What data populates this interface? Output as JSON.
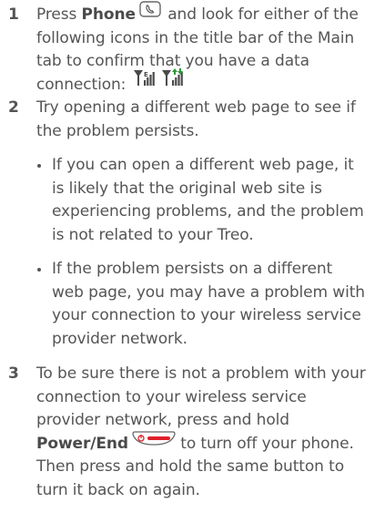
{
  "steps": [
    {
      "number": "1",
      "pre": "Press ",
      "bold": "Phone",
      "post": " and look for either of the following icons in the title bar of the Main tab to confirm that you have a data connection:",
      "icons": [
        "phone-key-icon",
        "signal-data-icon",
        "signal-data-active-icon"
      ]
    },
    {
      "number": "2",
      "text": "Try opening a different web page to see if the problem persists.",
      "bullets": [
        "If you can open a different web page, it is likely that the original web site is experiencing problems, and the problem is not related to your Treo.",
        "If the problem persists on a different web page, you may have a problem with your connection to your wireless service provider network."
      ]
    },
    {
      "number": "3",
      "pre": "To be sure there is not a problem with your connection to your wireless service provider network, press and hold ",
      "bold": "Power/End",
      "post": " to turn off your phone. Then press and hold the same button to turn it back on again.",
      "icons": [
        "power-end-key-icon"
      ]
    }
  ],
  "colors": {
    "text": "#555555",
    "power_red": "#e0202a",
    "signal_green": "#2a9a3a"
  }
}
